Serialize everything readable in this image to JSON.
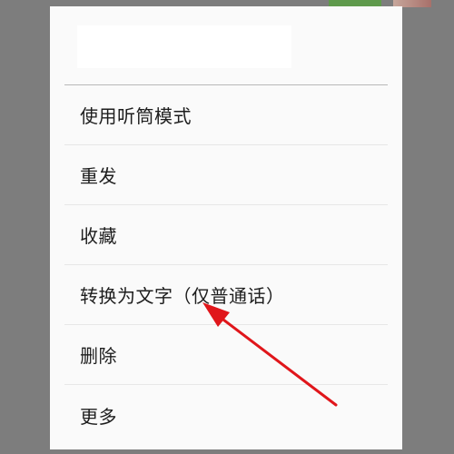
{
  "background": {
    "overlay_color": "#7d7d7d"
  },
  "context_menu": {
    "items": [
      {
        "label": "使用听筒模式"
      },
      {
        "label": "重发"
      },
      {
        "label": "收藏"
      },
      {
        "label": "转换为文字（仅普通话）"
      },
      {
        "label": "删除"
      },
      {
        "label": "更多"
      }
    ]
  },
  "annotation": {
    "arrow_color": "#e0161b",
    "target": "转换为文字（仅普通话）"
  }
}
